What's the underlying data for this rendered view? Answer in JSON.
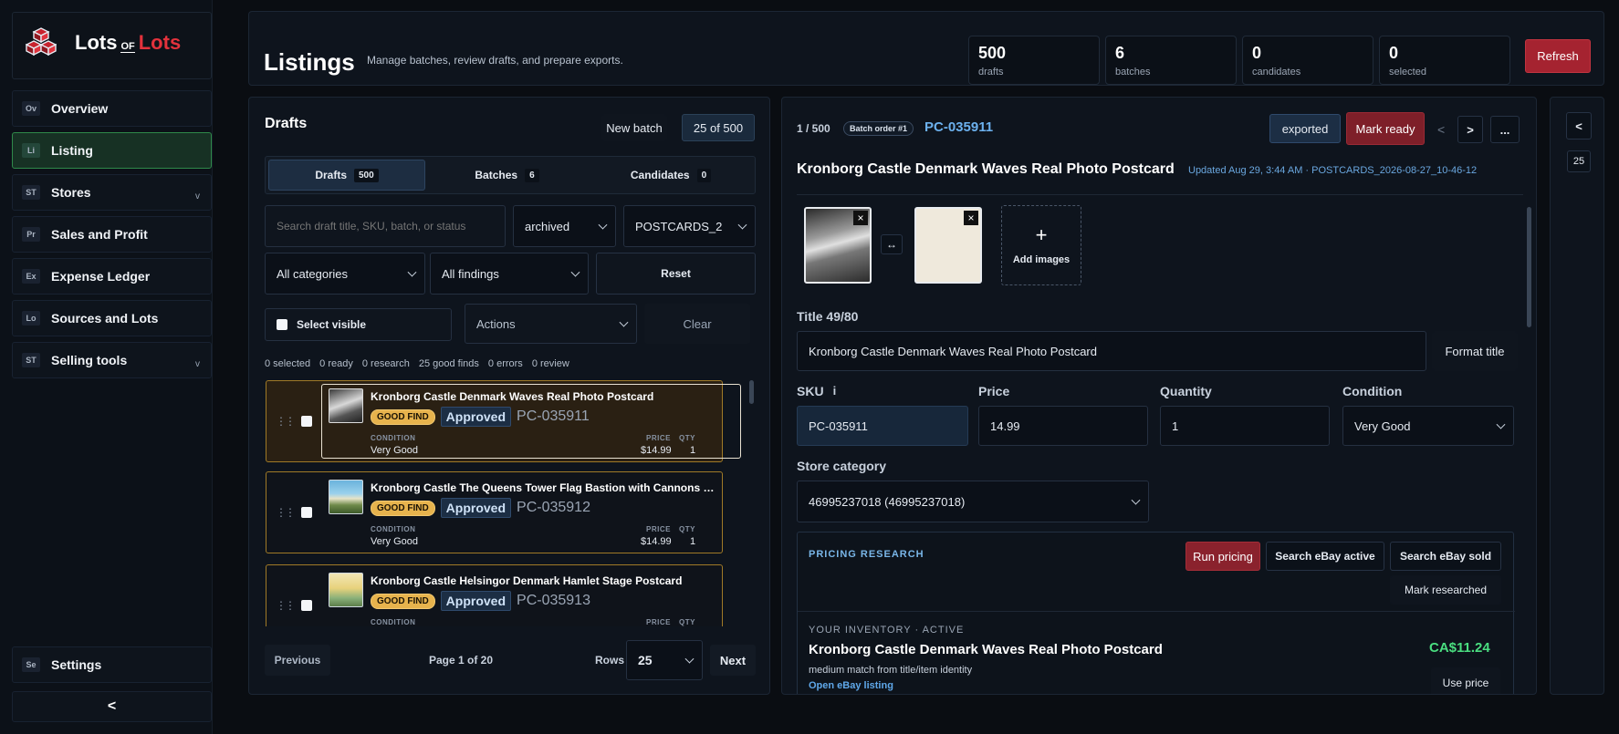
{
  "app": {
    "brand_part1": "Lots",
    "brand_of": "OF",
    "brand_part2": "Lots"
  },
  "sidebar": {
    "items": [
      {
        "abbr": "Ov",
        "label": "Overview"
      },
      {
        "abbr": "Li",
        "label": "Listing"
      },
      {
        "abbr": "ST",
        "label": "Stores",
        "chevron": "v"
      },
      {
        "abbr": "Pr",
        "label": "Sales and Profit"
      },
      {
        "abbr": "Ex",
        "label": "Expense Ledger"
      },
      {
        "abbr": "Lo",
        "label": "Sources and Lots"
      },
      {
        "abbr": "ST",
        "label": "Selling tools",
        "chevron": "v"
      }
    ],
    "settings": {
      "abbr": "Se",
      "label": "Settings"
    },
    "collapse": "<"
  },
  "header": {
    "title": "Listings",
    "subtitle": "Manage batches, review drafts, and prepare exports.",
    "stats": [
      {
        "value": "500",
        "label": "drafts"
      },
      {
        "value": "6",
        "label": "batches"
      },
      {
        "value": "0",
        "label": "candidates"
      },
      {
        "value": "0",
        "label": "selected"
      }
    ],
    "refresh": "Refresh"
  },
  "drafts_panel": {
    "title": "Drafts",
    "new_batch": "New batch",
    "range": "25 of 500",
    "tabs": [
      {
        "label": "Drafts",
        "count": "500"
      },
      {
        "label": "Batches",
        "count": "6"
      },
      {
        "label": "Candidates",
        "count": "0"
      }
    ],
    "search_placeholder": "Search draft title, SKU, batch, or status",
    "status_filter": "archived",
    "batch_filter": "POSTCARDS_2",
    "category_filter": "All categories",
    "findings_filter": "All findings",
    "reset": "Reset",
    "select_visible": "Select visible",
    "actions": "Actions",
    "clear": "Clear",
    "summary": [
      "0 selected",
      "0 ready",
      "0 research",
      "25 good finds",
      "0 errors",
      "0 review"
    ],
    "labels": {
      "condition": "CONDITION",
      "price": "PRICE",
      "qty": "QTY"
    },
    "items": [
      {
        "title": "Kronborg Castle Denmark Waves Real Photo Postcard",
        "tag": "GOOD FIND",
        "status": "Approved",
        "sku": "PC-035911",
        "condition": "Very Good",
        "price": "$14.99",
        "qty": "1"
      },
      {
        "title": "Kronborg Castle The Queens Tower Flag Bastion with Cannons Pos...",
        "tag": "GOOD FIND",
        "status": "Approved",
        "sku": "PC-035912",
        "condition": "Very Good",
        "price": "$14.99",
        "qty": "1"
      },
      {
        "title": "Kronborg Castle Helsingor Denmark Hamlet Stage Postcard",
        "tag": "GOOD FIND",
        "status": "Approved",
        "sku": "PC-035913",
        "condition": "",
        "price": "",
        "qty": ""
      }
    ],
    "pagination": {
      "previous": "Previous",
      "page": "Page 1 of 20",
      "rows_label": "Rows",
      "rows": "25",
      "next": "Next"
    }
  },
  "detail": {
    "position": "1 / 500",
    "batch_badge": "Batch order #1",
    "sku_link": "PC-035911",
    "exported": "exported",
    "mark_ready": "Mark ready",
    "prev": "<",
    "next": ">",
    "more": "...",
    "title": "Kronborg Castle Denmark Waves Real Photo Postcard",
    "updated": "Updated Aug 29, 3:44 AM · POSTCARDS_2026-08-27_10-46-12",
    "swap": "↔",
    "add_images": "Add images",
    "add_plus": "+",
    "remove": "×",
    "title_label": "Title 49/80",
    "title_value": "Kronborg Castle Denmark Waves Real Photo Postcard",
    "format_title": "Format title",
    "sku_label": "SKU",
    "info": "i",
    "sku_value": "PC-035911",
    "price_label": "Price",
    "price_value": "14.99",
    "qty_label": "Quantity",
    "qty_value": "1",
    "condition_label": "Condition",
    "condition_value": "Very Good",
    "store_cat_label": "Store category",
    "store_cat_value": "46995237018 (46995237018)",
    "pricing": {
      "heading": "PRICING RESEARCH",
      "run": "Run pricing",
      "search_active": "Search eBay active",
      "search_sold": "Search eBay sold",
      "mark_researched": "Mark researched",
      "inventory_label": "YOUR INVENTORY · ACTIVE",
      "item_title": "Kronborg Castle Denmark Waves Real Photo Postcard",
      "price": "CA$11.24",
      "match": "medium match from title/item identity",
      "open_link": "Open eBay listing",
      "use_price": "Use price"
    }
  },
  "right_rail": {
    "collapse": "<",
    "count": "25"
  }
}
